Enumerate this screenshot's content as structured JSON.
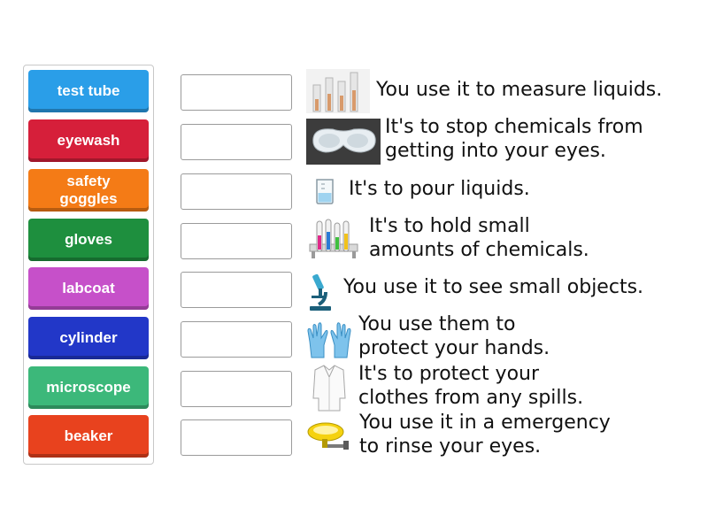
{
  "tiles": [
    {
      "label": "test tube",
      "color": "#2a9ee8"
    },
    {
      "label": "eyewash",
      "color": "#d61f3a"
    },
    {
      "label": "safety goggles",
      "color": "#f47b16"
    },
    {
      "label": "gloves",
      "color": "#1e8f3e"
    },
    {
      "label": "labcoat",
      "color": "#c650c9"
    },
    {
      "label": "cylinder",
      "color": "#2237c8"
    },
    {
      "label": "microscope",
      "color": "#3cb87a"
    },
    {
      "label": "beaker",
      "color": "#e8421e"
    }
  ],
  "descriptions": [
    {
      "line1": "You use it to measure liquids.",
      "line2": "",
      "icon": "graduated-cylinder-icon"
    },
    {
      "line1": "It's to stop chemicals from",
      "line2": "getting into your eyes.",
      "icon": "safety-goggles-icon"
    },
    {
      "line1": "It's to pour liquids.",
      "line2": "",
      "icon": "beaker-icon"
    },
    {
      "line1": "It's to hold small",
      "line2": "amounts of chemicals.",
      "icon": "test-tube-rack-icon"
    },
    {
      "line1": "You use it to see small objects.",
      "line2": "",
      "icon": "microscope-icon"
    },
    {
      "line1": "You use them to",
      "line2": "protect your hands.",
      "icon": "gloves-icon"
    },
    {
      "line1": "It's to protect your",
      "line2": "clothes from any spills.",
      "icon": "labcoat-icon"
    },
    {
      "line1": "You use it in a emergency",
      "line2": "to rinse your eyes.",
      "icon": "eyewash-station-icon"
    }
  ]
}
